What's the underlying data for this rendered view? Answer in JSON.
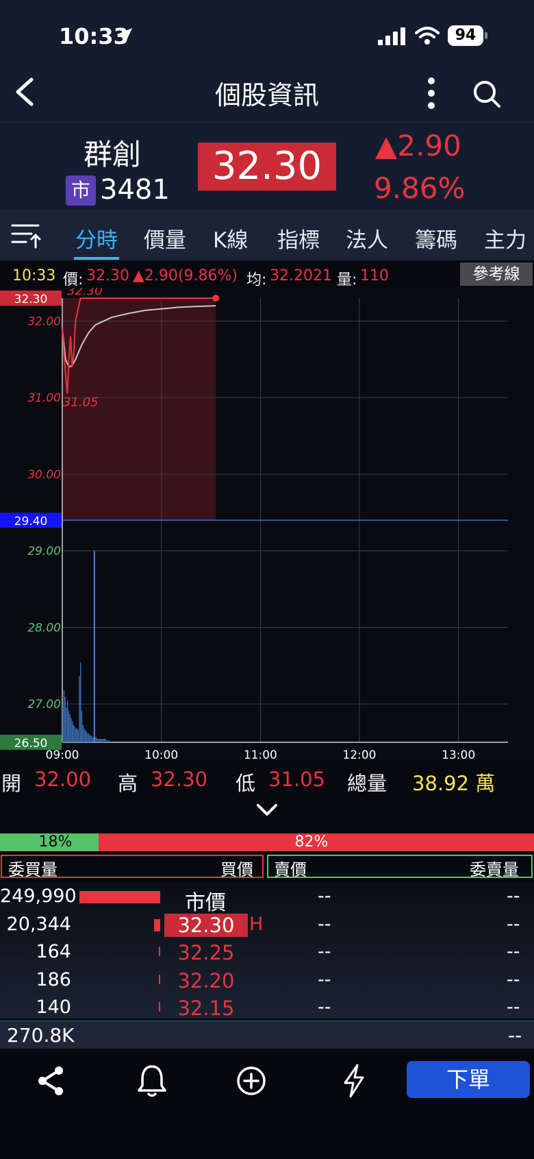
{
  "status_bar": {
    "time": "10:33",
    "battery": "94"
  },
  "header": {
    "title": "個股資訊"
  },
  "stock": {
    "name": "群創",
    "market_badge": "市",
    "code": "3481",
    "price": "32.30",
    "change": "▲2.90",
    "change_pct": "9.86%"
  },
  "tabs": [
    "分時",
    "價量",
    "K線",
    "指標",
    "法人",
    "籌碼",
    "主力"
  ],
  "info_bar": {
    "time": "10:33",
    "price_label": "價:",
    "price": "32.30",
    "change": "▲2.90(9.86%)",
    "avg_label": "均:",
    "avg": "32.2021",
    "vol_label": "量:",
    "vol": "110",
    "ref_button": "參考線"
  },
  "chart_data": {
    "type": "line",
    "y_ticks": [
      "32.00",
      "31.00",
      "30.00",
      "29.00",
      "28.00",
      "27.00"
    ],
    "y_ticks_values": [
      32,
      31,
      30,
      29,
      28,
      27
    ],
    "ylim": [
      26.5,
      32.3
    ],
    "x_ticks": [
      "09:00",
      "10:00",
      "11:00",
      "12:00",
      "13:00"
    ],
    "price_tag_high": "32.30",
    "price_tag_ref": "29.40",
    "price_tag_low": "26.50",
    "reference_price": 29.4,
    "annotation_high": "32.30",
    "annotation_low": "31.05",
    "series": [
      {
        "name": "價",
        "x": [
          0,
          1,
          2,
          3,
          4,
          5,
          6,
          7,
          8,
          9,
          10,
          11,
          12,
          14,
          16,
          20,
          25,
          30,
          40,
          50,
          60,
          70,
          80,
          93
        ],
        "values": [
          31.9,
          31.6,
          31.3,
          31.05,
          31.5,
          31.8,
          31.4,
          31.6,
          32.0,
          32.1,
          32.2,
          32.3,
          32.3,
          32.3,
          32.3,
          32.3,
          32.3,
          32.3,
          32.3,
          32.3,
          32.3,
          32.3,
          32.3,
          32.3
        ]
      },
      {
        "name": "均",
        "x": [
          0,
          2,
          4,
          6,
          8,
          10,
          12,
          16,
          20,
          30,
          40,
          50,
          60,
          70,
          80,
          93
        ],
        "values": [
          31.9,
          31.5,
          31.4,
          31.42,
          31.5,
          31.6,
          31.7,
          31.85,
          31.95,
          32.05,
          32.1,
          32.14,
          32.16,
          32.18,
          32.19,
          32.2
        ]
      }
    ],
    "volume_bars": [
      22,
      30,
      26,
      20,
      24,
      18,
      16,
      14,
      12,
      10,
      9,
      8,
      8,
      7,
      38,
      46,
      18,
      10,
      8,
      7,
      6,
      5,
      5,
      4,
      4,
      3,
      3,
      3,
      3,
      2,
      2,
      2,
      2,
      2,
      2,
      2,
      2,
      1,
      1,
      1
    ],
    "volume_max": 110
  },
  "stats": {
    "open_label": "開",
    "open": "32.00",
    "high_label": "高",
    "high": "32.30",
    "low_label": "低",
    "low": "31.05",
    "vol_label": "總量",
    "vol": "38.92 萬"
  },
  "ratio": {
    "buy_pct_text": "18%",
    "sell_pct_text": "82%",
    "buy_fraction": 0.18
  },
  "order_book": {
    "headers": {
      "bid_qty": "委買量",
      "bid_price": "買價",
      "ask_price": "賣價",
      "ask_qty": "委賣量"
    },
    "rows": [
      {
        "bid_qty": "249,990",
        "bid_price": "市價",
        "ask_price": "--",
        "ask_qty": "--",
        "bar": 1.0,
        "mark": ""
      },
      {
        "bid_qty": "20,344",
        "bid_price": "32.30",
        "ask_price": "--",
        "ask_qty": "--",
        "bar": 0.08,
        "mark": "H"
      },
      {
        "bid_qty": "164",
        "bid_price": "32.25",
        "ask_price": "--",
        "ask_qty": "--",
        "bar": 0.01,
        "mark": ""
      },
      {
        "bid_qty": "186",
        "bid_price": "32.20",
        "ask_price": "--",
        "ask_qty": "--",
        "bar": 0.01,
        "mark": ""
      },
      {
        "bid_qty": "140",
        "bid_price": "32.15",
        "ask_price": "--",
        "ask_qty": "--",
        "bar": 0.01,
        "mark": ""
      }
    ],
    "total_bid": "270.8K",
    "total_ask": "--"
  },
  "bottom": {
    "order_button": "下單"
  },
  "colors": {
    "up": "#e8343f",
    "accent": "#3db1ff",
    "ref_blue": "#1414ff",
    "low_green": "#2d7a3c",
    "order_blue": "#1f52d8"
  }
}
